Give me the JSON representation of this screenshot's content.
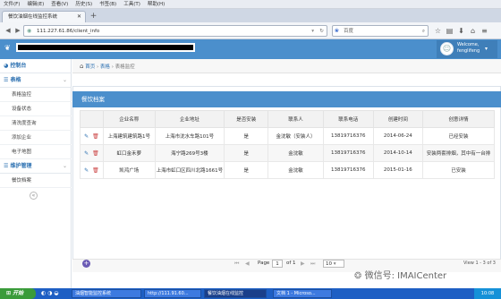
{
  "browser": {
    "menu": [
      "文件(F)",
      "编辑(E)",
      "查看(V)",
      "历史(S)",
      "书签(B)",
      "工具(T)",
      "帮助(H)"
    ],
    "tab_title": "餐饮油烟在线监控系统",
    "url": "111.227.61.86/client_info",
    "search_engine": "百度"
  },
  "app": {
    "user": {
      "welcome": "Welcome,",
      "name": "fenglifeng"
    }
  },
  "sidebar": {
    "dashboard": "控制台",
    "reports_header": "表格",
    "items": [
      "表格监控",
      "设备状态",
      "清洗度查询",
      "添加企业",
      "电子地图"
    ],
    "system_header": "维护管理",
    "system_items": [
      "餐饮档案"
    ]
  },
  "breadcrumb": {
    "home": "首页",
    "sep1": "›",
    "level1": "表格",
    "sep2": "›",
    "level2": "表格监控"
  },
  "panel": {
    "title": "餐饮档案",
    "columns": [
      "企业名称",
      "企业地址",
      "是否安装",
      "联系人",
      "联系电话",
      "创建时间",
      "创意详情"
    ],
    "rows": [
      [
        "上海建筑建筑路1号",
        "上海市沈水车路101号",
        "是",
        "金沈敏（安装人）",
        "13819716376",
        "2014-06-24",
        "已经安装"
      ],
      [
        "虹口金禾萝",
        "海宁路269号3楼",
        "是",
        "金沈敏",
        "13819716376",
        "2014-10-14",
        "安装两套排烟，其中有一台排"
      ],
      [
        "凯鸿广场",
        "上海市虹口区四川北路1661号",
        "是",
        "金沈敏",
        "13819716376",
        "2015-01-16",
        "已安装"
      ]
    ]
  },
  "pager": {
    "page_label": "Page",
    "page": "1",
    "of": "of 1",
    "size": "10",
    "view_info": "View 1 - 3 of 3"
  },
  "watermark": "微信号: IMAICenter",
  "taskbar": {
    "start": "开始",
    "tasks": [
      "油烟智能监控系统",
      "http://111.91.60...",
      "餐饮油烟在线监控",
      "文档 1 - Microso..."
    ],
    "clock": "10:08"
  }
}
